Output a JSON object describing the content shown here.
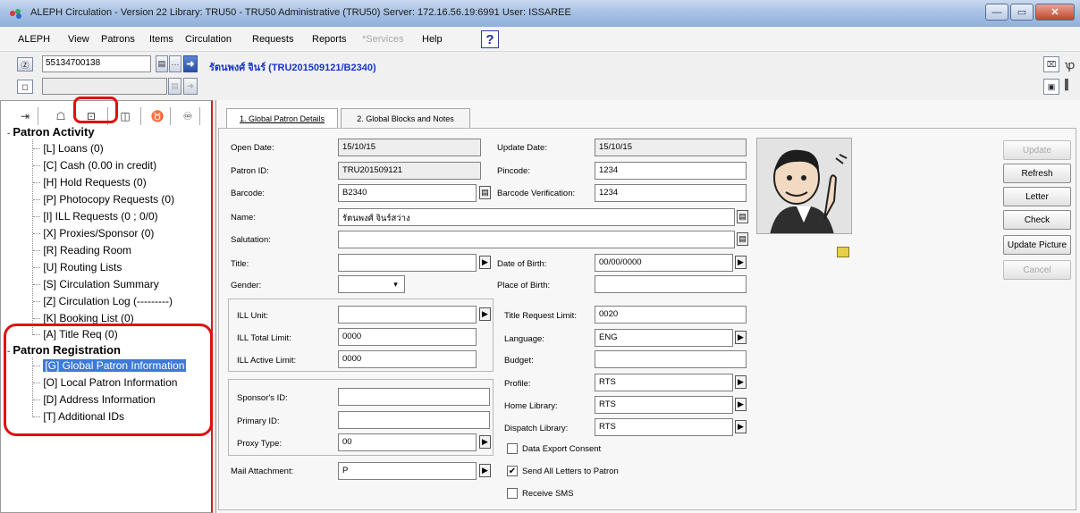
{
  "window": {
    "title": "ALEPH Circulation - Version 22  Library: TRU50 - TRU50  Administrative (TRU50)  Server: 172.16.56.19:6991  User: ISSAREE"
  },
  "menu": [
    "ALEPH",
    "View",
    "Patrons",
    "Items",
    "Circulation",
    "Requests",
    "Reports",
    "*Services",
    "Help"
  ],
  "toolbar": {
    "barcode_value": "55134700138",
    "patron_header": "รัตนพงศ์ จินร์ (TRU201509121/B2340)"
  },
  "left": {
    "activity_title": "Patron Activity",
    "activity_items": [
      "[L] Loans (0)",
      "[C] Cash (0.00 in credit)",
      "[H] Hold Requests (0)",
      "[P] Photocopy Requests (0)",
      "[I] ILL Requests (0 ; 0/0)",
      "[X] Proxies/Sponsor (0)",
      "[R] Reading Room",
      "[U] Routing Lists",
      "[S] Circulation Summary",
      "[Z] Circulation Log (---------)",
      "[K] Booking List (0)",
      "[A] Title Req (0)"
    ],
    "registration_title": "Patron Registration",
    "registration_items": [
      "[G] Global Patron Information",
      "[O] Local Patron Information",
      "[D] Address Information",
      "[T] Additional IDs"
    ]
  },
  "tabs": [
    "1. Global Patron Details",
    "2. Global Blocks and Notes"
  ],
  "form": {
    "open_date_label": "Open Date:",
    "open_date": "15/10/15",
    "update_date_label": "Update Date:",
    "update_date": "15/10/15",
    "patron_id_label": "Patron ID:",
    "patron_id": "TRU201509121",
    "pincode_label": "Pincode:",
    "pincode": "1234",
    "barcode_label": "Barcode:",
    "barcode": "B2340",
    "barcode_verif_label": "Barcode Verification:",
    "barcode_verif": "1234",
    "name_label": "Name:",
    "name": "รัตนพงศ์ จินร์สว่าง",
    "salutation_label": "Salutation:",
    "salutation": "",
    "title_label": "Title:",
    "title": "",
    "dob_label": "Date of Birth:",
    "dob": "00/00/0000",
    "gender_label": "Gender:",
    "gender": "",
    "pob_label": "Place of Birth:",
    "pob": "",
    "ill_unit_label": "ILL Unit:",
    "ill_unit": "",
    "title_req_limit_label": "Title Request Limit:",
    "title_req_limit": "0020",
    "ill_total_label": "ILL Total Limit:",
    "ill_total": "0000",
    "language_label": "Language:",
    "language": "ENG",
    "ill_active_label": "ILL Active Limit:",
    "ill_active": "0000",
    "budget_label": "Budget:",
    "budget": "",
    "profile_label": "Profile:",
    "profile": "RTS",
    "sponsor_label": "Sponsor's ID:",
    "sponsor": "",
    "home_lib_label": "Home Library:",
    "home_lib": "RTS",
    "primary_label": "Primary ID:",
    "primary": "",
    "dispatch_label": "Dispatch Library:",
    "dispatch": "RTS",
    "proxy_label": "Proxy Type:",
    "proxy": "00",
    "data_export_label": "Data Export Consent",
    "mail_label": "Mail Attachment:",
    "mail": "P",
    "send_letters_label": "Send All Letters to Patron",
    "receive_sms_label": "Receive SMS"
  },
  "checkboxes": {
    "data_export": false,
    "send_letters": true,
    "receive_sms": false
  },
  "buttons": [
    "Update",
    "Refresh",
    "Letter",
    "Check",
    "Update Picture",
    "Cancel"
  ],
  "colors": {
    "annotation": "#e01010",
    "selection": "#3b7bd8",
    "header_link": "#1a35c8"
  }
}
